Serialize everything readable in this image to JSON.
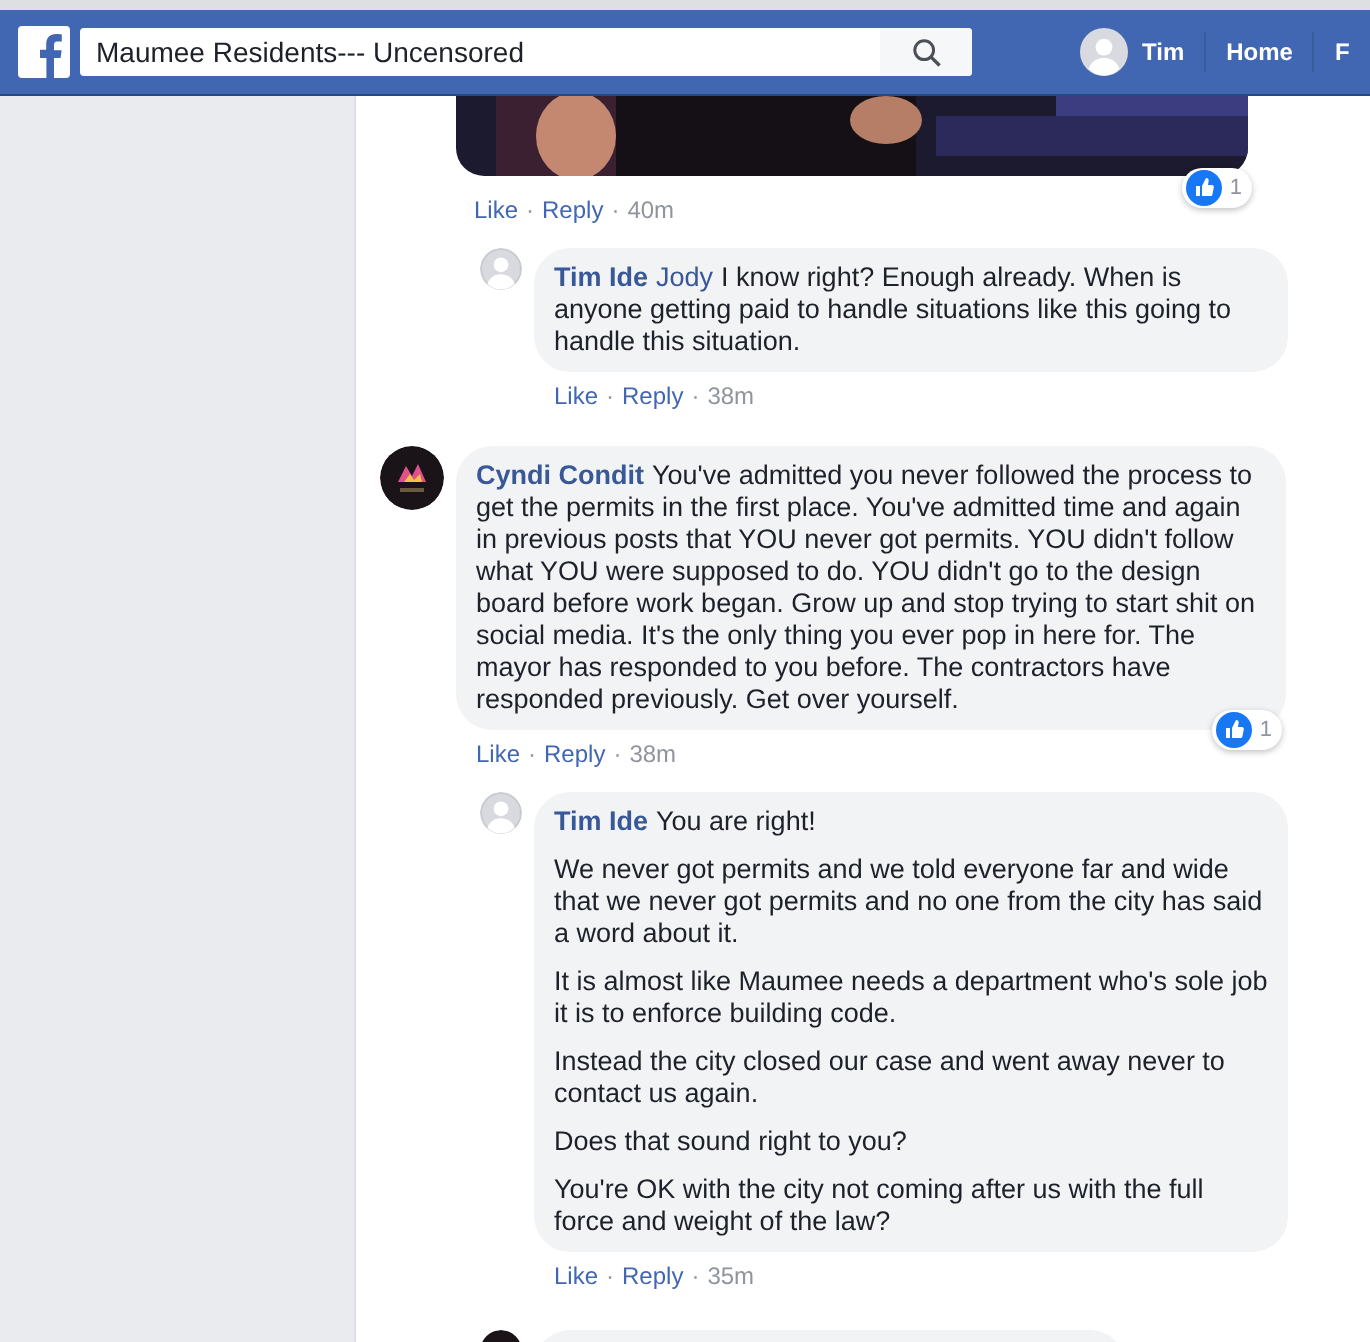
{
  "header": {
    "search": {
      "value": "Maumee Residents--- Uncensored"
    },
    "profile_name": "Tim",
    "nav": [
      "Home",
      "F"
    ]
  },
  "separator": "·",
  "gif_post": {
    "kind": "picture",
    "actions": [
      "Like",
      "Reply"
    ],
    "time": "40m",
    "reactions": "1"
  },
  "comments": [
    {
      "kind": "reply",
      "author": "Tim Ide",
      "mention": "Jody",
      "paragraphs": [
        "I know right? Enough already. When is anyone getting paid to handle situations like this going to handle this situation."
      ],
      "actions": [
        "Like",
        "Reply"
      ],
      "time": "38m"
    },
    {
      "kind": "comment",
      "author": "Cyndi Condit",
      "paragraphs": [
        "You've admitted you never followed the process to get the permits in the first place. You've admitted time and again in previous posts that YOU never got permits. YOU didn't follow what YOU were supposed to do. YOU didn't go to the design board before work began. Grow up and stop trying to start shit on social media. It's the only thing you ever pop in here for. The mayor has responded to you before. The contractors have responded previously. Get over yourself."
      ],
      "actions": [
        "Like",
        "Reply"
      ],
      "time": "38m",
      "reactions": "1"
    },
    {
      "kind": "reply",
      "author": "Tim Ide",
      "paragraphs": [
        "You are right!",
        "We never got permits and we told everyone far and wide that we never got permits and no one from the city has said a word about it.",
        "It is almost like Maumee needs a department who's sole job it is to enforce building code.",
        "Instead the city closed our case and went away never to contact us again.",
        "Does that sound right to you?",
        "You're OK with the city not coming after us with the full force and weight of the law?"
      ],
      "actions": [
        "Like",
        "Reply"
      ],
      "time": "35m"
    },
    {
      "kind": "partial"
    }
  ]
}
